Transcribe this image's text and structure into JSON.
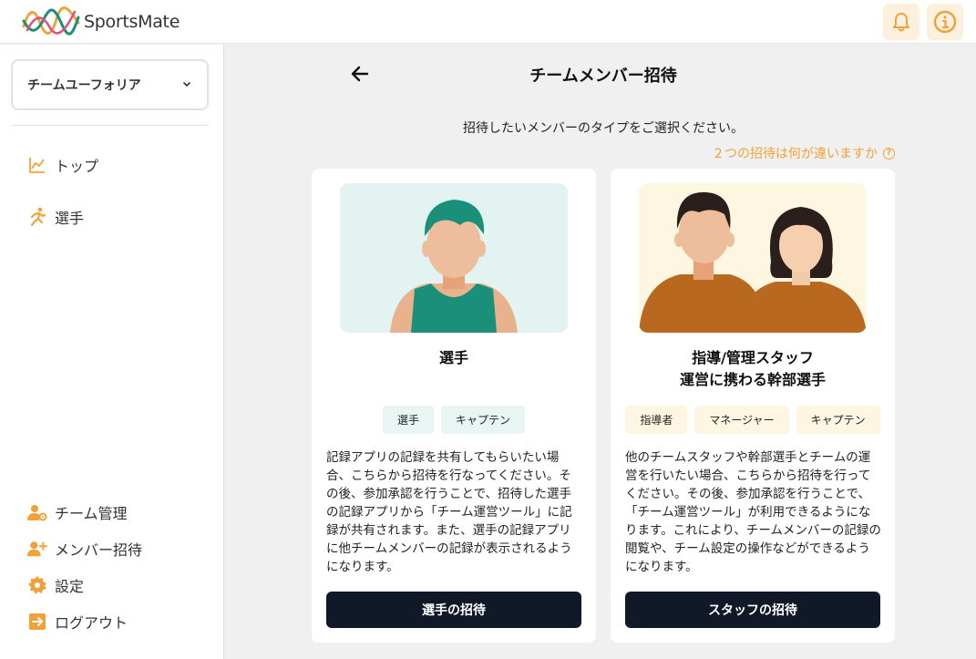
{
  "app": {
    "name": "SportsMate"
  },
  "sidebar": {
    "team_name": "チームユーフォリア",
    "nav_top": [
      {
        "label": "トップ",
        "icon": "chart-line-icon"
      },
      {
        "label": "選手",
        "icon": "runner-icon"
      }
    ],
    "nav_bottom": [
      {
        "label": "チーム管理",
        "icon": "team-manage-icon"
      },
      {
        "label": "メンバー招待",
        "icon": "add-user-icon"
      },
      {
        "label": "設定",
        "icon": "gear-icon"
      },
      {
        "label": "ログアウト",
        "icon": "logout-icon"
      }
    ]
  },
  "page": {
    "title": "チームメンバー招待",
    "subtitle": "招待したいメンバーのタイプをご選択ください。",
    "diff_link": "２つの招待は何が違いますか"
  },
  "cards": {
    "player": {
      "title": "選手",
      "tags": [
        "選手",
        "キャプテン"
      ],
      "description": "記録アプリの記録を共有してもらいたい場合、こちらから招待を行なってください。その後、参加承認を行うことで、招待した選手の記録アプリから「チーム運営ツール」に記録が共有されます。また、選手の記録アプリに他チームメンバーの記録が表示されるようになります。",
      "button": "選手の招待"
    },
    "staff": {
      "title_line1": "指導/管理スタッフ",
      "title_line2": "運営に携わる幹部選手",
      "tags": [
        "指導者",
        "マネージャー",
        "キャプテン"
      ],
      "description": "他のチームスタッフや幹部選手とチームの運営を行いたい場合、こちらから招待を行ってください。その後、参加承認を行うことで、「チーム運営ツール」が利用できるようになります。これにより、チームメンバーの記録の閲覧や、チーム設定の操作などができるようになります。",
      "button": "スタッフの招待"
    }
  },
  "colors": {
    "accent": "#f0a23a",
    "button": "#111827",
    "teal": "#1a8f7a"
  }
}
